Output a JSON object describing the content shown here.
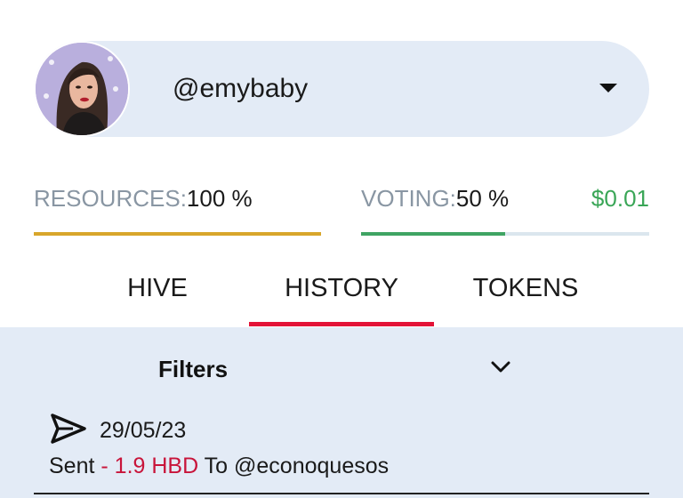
{
  "account": {
    "username": "@emybaby",
    "avatar_icon": "user-avatar-photo",
    "dropdown_icon": "caret-down-icon"
  },
  "stats": {
    "resources_label": "RESOURCES:",
    "resources_value": "100 %",
    "resources_level": 1.0,
    "voting_label": "VOTING:",
    "voting_value": "50 %",
    "voting_level": 0.5,
    "balance": "$0.01"
  },
  "tabs": [
    {
      "label": "HIVE",
      "active": false
    },
    {
      "label": "HISTORY",
      "active": true
    },
    {
      "label": "TOKENS",
      "active": false
    }
  ],
  "filters": {
    "label": "Filters",
    "icon": "chevron-down-icon"
  },
  "transactions": [
    {
      "icon": "send-icon",
      "date": "29/05/23",
      "action": "Sent",
      "amount": "- 1.9 HBD",
      "preposition": "To",
      "counterparty": "@econoquesos"
    }
  ],
  "colors": {
    "accent_red": "#e31337",
    "resources_bar": "#d8a62b",
    "voting_bar": "#3fa463",
    "balance_green": "#3aa657",
    "panel_bg": "#e3ebf6"
  }
}
